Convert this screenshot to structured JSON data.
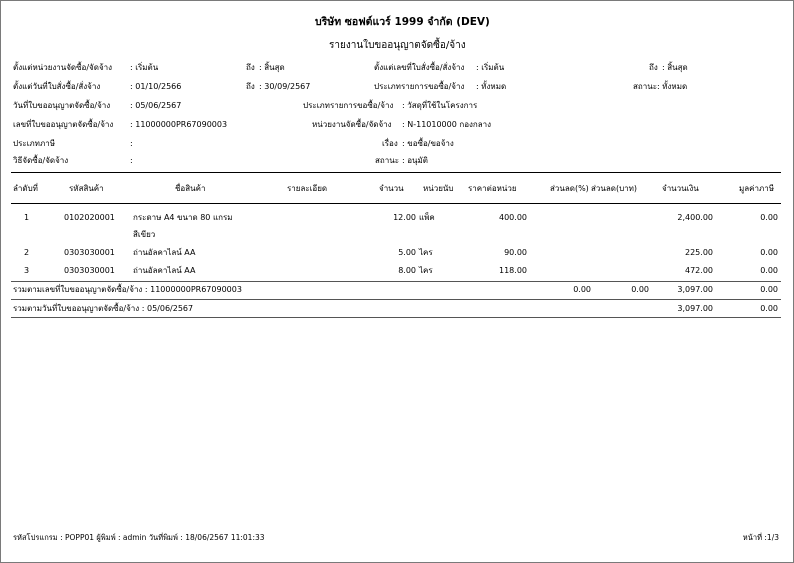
{
  "report": {
    "company": "บริษัท ซอฟต์แวร์ 1999 จำกัด (DEV)",
    "title": "รายงานใบขออนุญาตจัดซื้อ/จ้าง"
  },
  "filters": {
    "unit_from_label": "ตั้งแต่หน่วยงานจัดซื้อ/จัดจ้าง",
    "unit_from_value": ": เริ่มต้น",
    "unit_to_label": "ถึง",
    "unit_to_value": ": สิ้นสุด",
    "po_no_from_label": "ตั้งแต่เลขที่ใบสั่งซื้อ/สั่งจ้าง",
    "po_no_from_value": ": เริ่มต้น",
    "po_no_to_label": "ถึง",
    "po_no_to_value": ": สิ้นสุด",
    "date_from_label": "ตั้งแต่วันที่ใบสั่งซื้อ/สั่งจ้าง",
    "date_from_value": ": 01/10/2566",
    "date_to_label": "ถึง",
    "date_to_value": ": 30/09/2567",
    "req_type_label": "ประเภทรายการขอซื้อ/จ้าง",
    "req_type_value": ": ทั้งหมด",
    "status_label": "สถานะ",
    "status_value": ": ทั้งหมด"
  },
  "doc": {
    "date_label": "วันที่ใบขออนุญาตจัดซื้อ/จ้าง",
    "date_value": ": 05/06/2567",
    "item_type_label": "ประเภทรายการขอซื้อ/จ้าง",
    "item_type_value": ": วัสดุที่ใช้ในโครงการ",
    "no_label": "เลขที่ใบขออนุญาตจัดซื้อ/จ้าง",
    "no_value": ": 11000000PR67090003",
    "unit_label": "หน่วยงานจัดซื้อ/จัดจ้าง",
    "unit_value": ": N-11010000 กองกลาง",
    "tax_type_label": "ประเภทภาษี",
    "tax_type_value": ":",
    "subject_label": "เรื่อง",
    "subject_value": ": ขอซื้อ/ขอจ้าง",
    "method_label": "วิธีจัดซื้อ/จัดจ้าง",
    "method_value": ":",
    "status_label": "สถานะ",
    "status_value": ": อนุมัติ"
  },
  "table": {
    "headers": {
      "seq": "ลำดับที่",
      "code": "รหัสสินค้า",
      "name": "ชื่อสินค้า",
      "detail": "รายละเอียด",
      "qty": "จำนวน",
      "unit": "หน่วยนับ",
      "price": "ราคาต่อหน่วย",
      "disc_pct": "ส่วนลด(%)",
      "disc_amt": "ส่วนลด(บาท)",
      "amount": "จำนวนเงิน",
      "vat": "มูลค่าภาษี"
    },
    "rows": [
      {
        "seq": "1",
        "code": "0102020001",
        "name": "กระดาษ A4  ขนาด 80 แกรม",
        "name2": "สีเขียว",
        "qty": "12.00",
        "unit": "แพ็ค",
        "price": "400.00",
        "amount": "2,400.00",
        "vat": "0.00"
      },
      {
        "seq": "2",
        "code": "0303030001",
        "name": "ถ่านอัลคาไลน์ AA",
        "name2": "",
        "qty": "5.00",
        "unit": "ไคร",
        "price": "90.00",
        "amount": "225.00",
        "vat": "0.00"
      },
      {
        "seq": "3",
        "code": "0303030001",
        "name": "ถ่านอัลคาไลน์ AA",
        "name2": "",
        "qty": "8.00",
        "unit": "ไคร",
        "price": "118.00",
        "amount": "472.00",
        "vat": "0.00"
      }
    ],
    "subtotal_label": "รวมตามเลขที่ใบขออนุญาตจัดซื้อ/จ้าง : 11000000PR67090003",
    "subtotal_disc_pct": "0.00",
    "subtotal_disc_amt": "0.00",
    "subtotal_amount": "3,097.00",
    "subtotal_vat": "0.00",
    "total_label": "รวมตามวันที่ใบขออนุญาตจัดซื้อ/จ้าง : 05/06/2567",
    "total_amount": "3,097.00",
    "total_vat": "0.00"
  },
  "footer": {
    "info": "รหัสโปรแกรม : POPP01 ผู้พิมพ์ : admin วันที่พิมพ์ : 18/06/2567 11:01:33",
    "page": "หน้าที่ :1/3"
  }
}
